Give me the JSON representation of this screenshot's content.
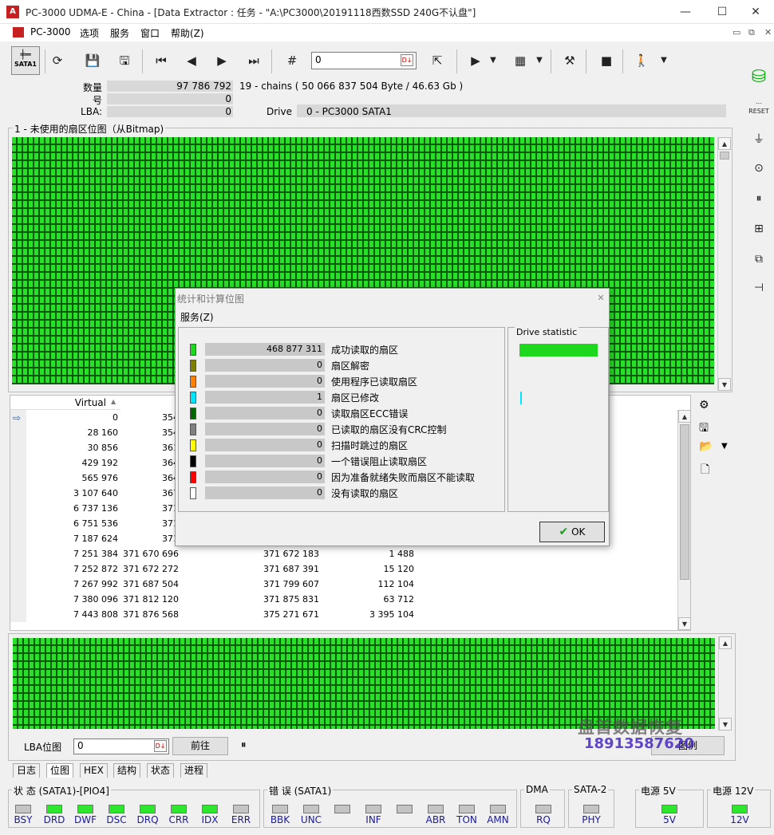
{
  "window": {
    "title": "PC-3000 UDMA-E - China - [Data Extractor : 任务 - \"A:\\PC3000\\20191118西数SSD 240G不认盘\"]",
    "logo_text": "A",
    "buttons": {
      "minimize": "—",
      "maximize": "☐",
      "close": "✕"
    }
  },
  "menu": {
    "items": [
      "PC-3000",
      "选项",
      "服务",
      "窗口",
      "帮助(Z)"
    ],
    "mdi": {
      "minimize": "▭",
      "restore": "⧉",
      "close": "✕"
    }
  },
  "toolbar": {
    "sata_label": "SATA1",
    "input_value": "0",
    "input_icon": "D↓"
  },
  "info": {
    "count_label": "数量",
    "count_value": "97 786 792",
    "count_extra": "19 - chains  ( 50 066 837 504 Byte /  46.63 Gb )",
    "num_label": "号",
    "num_value": "0",
    "lba_label": "LBA:",
    "lba_value": "0",
    "drive_label": "Drive",
    "drive_value": "0 - PC3000 SATA1"
  },
  "bitmap": {
    "group_title": "1 - 未使用的扇区位图（从Bitmap)"
  },
  "table": {
    "headers": [
      "Virtual"
    ],
    "sort_indicator": "▲",
    "rows": [
      [
        "0",
        "354",
        "",
        ""
      ],
      [
        "28 160",
        "354",
        "",
        ""
      ],
      [
        "30 856",
        "361",
        "",
        ""
      ],
      [
        "429 192",
        "364",
        "",
        ""
      ],
      [
        "565 976",
        "364",
        "",
        ""
      ],
      [
        "3 107 640",
        "367",
        "",
        ""
      ],
      [
        "6 737 136",
        "371",
        "",
        ""
      ],
      [
        "6 751 536",
        "371",
        "",
        ""
      ],
      [
        "7 187 624",
        "371",
        "",
        ""
      ],
      [
        "7 251 384",
        "371 670 696",
        "371 672 183",
        "1 488"
      ],
      [
        "7 252 872",
        "371 672 272",
        "371 687 391",
        "15 120"
      ],
      [
        "7 267 992",
        "371 687 504",
        "371 799 607",
        "112 104"
      ],
      [
        "7 380 096",
        "371 812 120",
        "371 875 831",
        "63 712"
      ],
      [
        "7 443 808",
        "371 876 568",
        "375 271 671",
        "3 395 104"
      ]
    ]
  },
  "lba_nav": {
    "label": "LBA位图",
    "input_value": "0",
    "input_icon": "D↓",
    "go_button": "前往",
    "pause_icon": "⏸",
    "legend_button": "图例"
  },
  "watermark": {
    "line1": "盘首数据恢复",
    "line2": "18913587620"
  },
  "tabs": [
    "日志",
    "位图",
    "HEX",
    "结构",
    "状态",
    "进程"
  ],
  "active_tab": "位图",
  "dialog": {
    "title": "统计和计算位图",
    "menu": "服务(Z)",
    "close": "✕",
    "stats": [
      {
        "color": "#1ed81e",
        "value": "468 877 311",
        "label": "成功读取的扇区"
      },
      {
        "color": "#808000",
        "value": "0",
        "label": "扇区解密"
      },
      {
        "color": "#ff8000",
        "value": "0",
        "label": "使用程序已读取扇区"
      },
      {
        "color": "#00e5ff",
        "value": "1",
        "label": "扇区已修改"
      },
      {
        "color": "#006400",
        "value": "0",
        "label": "读取扇区ECC错误"
      },
      {
        "color": "#808080",
        "value": "0",
        "label": "已读取的扇区没有CRC控制"
      },
      {
        "color": "#ffff00",
        "value": "0",
        "label": "扫描时跳过的扇区"
      },
      {
        "color": "#000000",
        "value": "0",
        "label": "一个错误阻止读取扇区"
      },
      {
        "color": "#ff0000",
        "value": "0",
        "label": "因为准备就绪失败而扇区不能读取"
      },
      {
        "color": "#ffffff",
        "value": "0",
        "label": "没有读取的扇区"
      }
    ],
    "drive_statistic_title": "Drive statistic",
    "drive_statistic_fill": 1.0,
    "ok_label": "OK",
    "ok_icon": "✔"
  },
  "status": {
    "state_title": "状 态 (SATA1)-[PIO4]",
    "state_leds": [
      {
        "label": "BSY",
        "on": false
      },
      {
        "label": "DRD",
        "on": true
      },
      {
        "label": "DWF",
        "on": true
      },
      {
        "label": "DSC",
        "on": true
      },
      {
        "label": "DRQ",
        "on": true
      },
      {
        "label": "CRR",
        "on": true
      },
      {
        "label": "IDX",
        "on": true
      },
      {
        "label": "ERR",
        "on": false
      }
    ],
    "error_title": "错 误 (SATA1)",
    "error_leds": [
      {
        "label": "BBK",
        "on": false
      },
      {
        "label": "UNC",
        "on": false
      },
      {
        "label": "",
        "on": false
      },
      {
        "label": "INF",
        "on": false
      },
      {
        "label": "",
        "on": false
      },
      {
        "label": "ABR",
        "on": false
      },
      {
        "label": "TON",
        "on": false
      },
      {
        "label": "AMN",
        "on": false
      }
    ],
    "dma_title": "DMA",
    "dma_led": {
      "label": "RQ",
      "on": false
    },
    "sata2_title": "SATA-2",
    "sata2_led": {
      "label": "PHY",
      "on": false
    },
    "power5_title": "电源 5V",
    "power5_led": {
      "label": "5V",
      "on": true
    },
    "power12_title": "电源 12V",
    "power12_led": {
      "label": "12V",
      "on": true
    }
  },
  "colors": {
    "bitmap_green": "#21e321",
    "led_on": "#2ee62e",
    "accent_red": "#c62020",
    "led_label_blue": "#1a1aa0"
  }
}
